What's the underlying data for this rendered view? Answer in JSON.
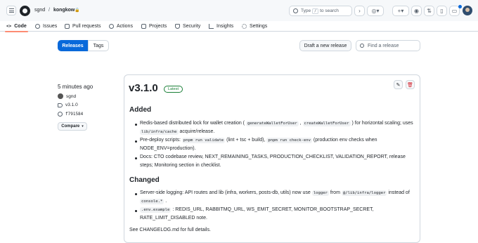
{
  "header": {
    "owner": "sgnd",
    "separator": "/",
    "repo": "kongkow",
    "lock": "🔒",
    "search_label": "Type",
    "search_key": "/",
    "search_suffix": "to search"
  },
  "nav": {
    "tabs": [
      {
        "label": "Code"
      },
      {
        "label": "Issues"
      },
      {
        "label": "Pull requests"
      },
      {
        "label": "Actions"
      },
      {
        "label": "Projects"
      },
      {
        "label": "Security"
      },
      {
        "label": "Insights"
      },
      {
        "label": "Settings"
      }
    ]
  },
  "subnav": {
    "releases_label": "Releases",
    "tags_label": "Tags",
    "draft_label": "Draft a new release",
    "find_placeholder": "Find a release"
  },
  "release": {
    "time": "5 minutes ago",
    "author": "sgnd",
    "tag": "v3.1.0",
    "commit": "f791584",
    "compare_label": "Compare",
    "version": "v3.1.0",
    "badge": "Latest",
    "added_heading": "Added",
    "changed_heading": "Changed",
    "footer": "See CHANGELOG.md for full details."
  },
  "icons": {
    "edit": "pencil-icon",
    "delete": "trash-icon"
  },
  "colors": {
    "accent": "#0969da",
    "latest": "#1a7f37",
    "active_tab": "#fd8c73",
    "delete": "#d1242f"
  }
}
